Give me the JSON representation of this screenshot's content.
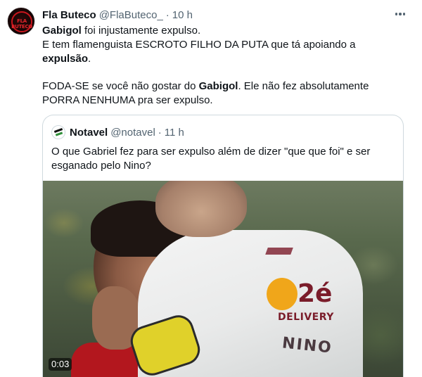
{
  "tweet": {
    "author": {
      "name": "Fla Buteco",
      "handle": "@FlaButeco_",
      "separator": "·",
      "time": "10 h",
      "avatar_text": "FLA BUTECO"
    },
    "more_icon": "more-horizontal-icon",
    "lines": {
      "l1_bold": "Gabigol",
      "l1_rest": " foi injustamente expulso.",
      "l2": "E tem flamenguista ESCROTO FILHO DA PUTA que tá apoiando a",
      "l3_bold": "expulsão",
      "l3_rest": ".",
      "l4_a": "FODA-SE se você não gostar do ",
      "l4_bold": "Gabigol",
      "l4_b": ". Ele não fez absolutamente",
      "l5": "PORRA NENHUMA pra ser expulso."
    }
  },
  "quote": {
    "author": {
      "name": "Notavel",
      "handle": "@notavel",
      "separator": "·",
      "time": "11 h"
    },
    "line1": "O que Gabriel fez para ser expulso além de dizer \"que que foi\" e ser",
    "line2": "esganado pelo Nino?",
    "video": {
      "duration": "0:03",
      "sponsor_mark": "2é",
      "sponsor_word": "DELIVERY",
      "jersey_name": "NINO"
    }
  },
  "colors": {
    "text": "#0f1419",
    "secondary": "#536471",
    "border": "#cfd9de"
  }
}
